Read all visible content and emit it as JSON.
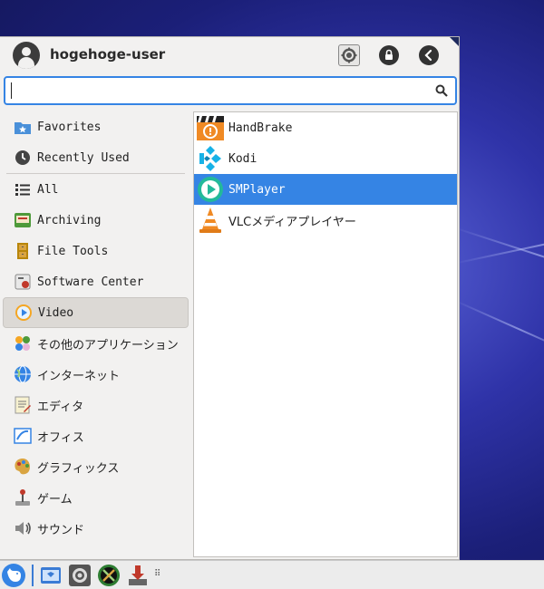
{
  "header": {
    "user_name": "hogehoge-user"
  },
  "search": {
    "value": "",
    "placeholder": ""
  },
  "categories": [
    {
      "label": "Favorites",
      "icon": "favorites-folder-icon"
    },
    {
      "label": "Recently Used",
      "icon": "clock-icon"
    },
    {
      "label": "All",
      "icon": "list-icon"
    },
    {
      "label": "Archiving",
      "icon": "archive-icon"
    },
    {
      "label": "File Tools",
      "icon": "file-cabinet-icon"
    },
    {
      "label": "Software Center",
      "icon": "software-center-icon"
    },
    {
      "label": "Video",
      "icon": "video-icon",
      "active": true
    },
    {
      "label": "その他のアプリケーション",
      "icon": "other-apps-icon"
    },
    {
      "label": "インターネット",
      "icon": "globe-icon"
    },
    {
      "label": "エディタ",
      "icon": "editor-icon"
    },
    {
      "label": "オフィス",
      "icon": "office-icon"
    },
    {
      "label": "グラフィックス",
      "icon": "graphics-palette-icon"
    },
    {
      "label": "ゲーム",
      "icon": "joystick-icon"
    },
    {
      "label": "サウンド",
      "icon": "speaker-icon"
    }
  ],
  "apps": [
    {
      "label": "HandBrake",
      "icon": "handbrake-icon"
    },
    {
      "label": "Kodi",
      "icon": "kodi-icon"
    },
    {
      "label": "SMPlayer",
      "icon": "smplayer-icon",
      "selected": true
    },
    {
      "label": "VLCメディアプレイヤー",
      "icon": "vlc-cone-icon"
    }
  ],
  "taskbar": {
    "grip": "⠿"
  },
  "colors": {
    "accent": "#3584e4",
    "menu_bg": "#f2f1f0",
    "active_category_bg": "#dcd9d5",
    "panel_bg": "#ffffff"
  }
}
